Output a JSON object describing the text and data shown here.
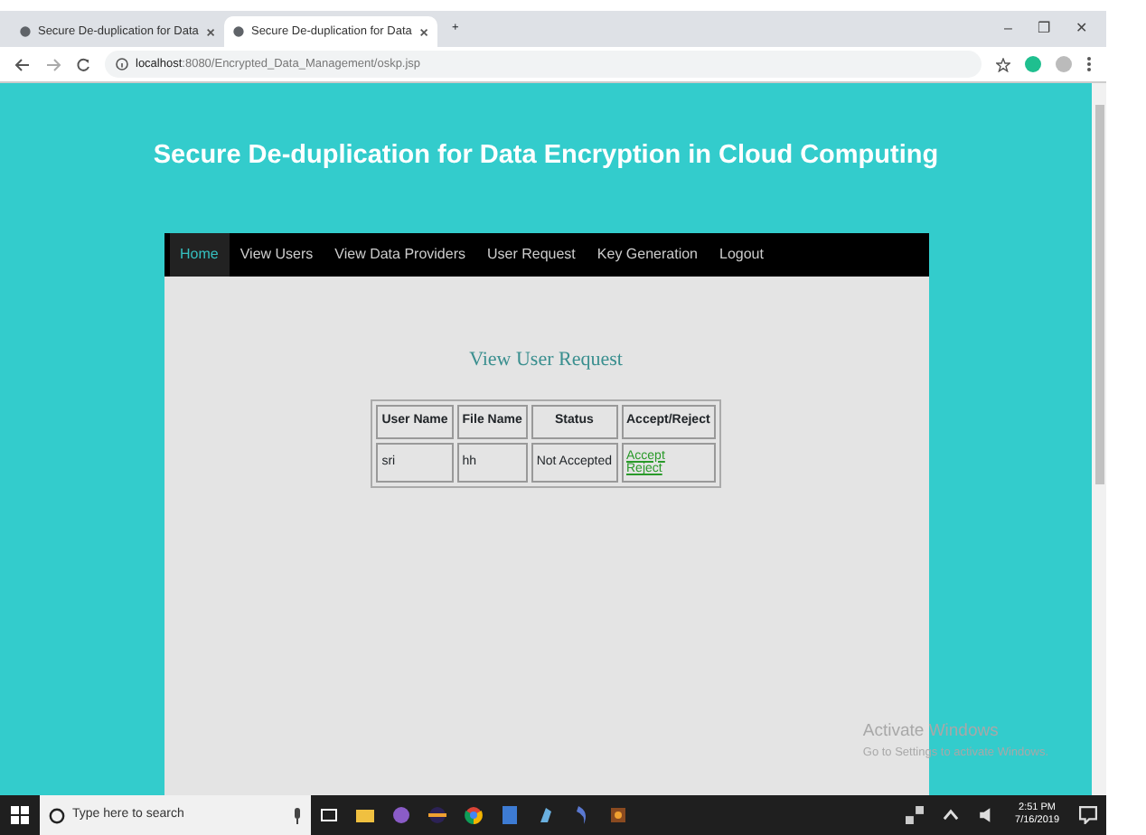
{
  "browser": {
    "tabs": [
      {
        "title": "Secure De-duplication for Data",
        "selected": false
      },
      {
        "title": "Secure De-duplication for Data",
        "selected": true
      }
    ],
    "new_tab": "+",
    "window_controls": [
      "–",
      "❐",
      "✕"
    ],
    "url_host": "localhost",
    "url_path": ":8080/Encrypted_Data_Management/oskp.jsp"
  },
  "page": {
    "title": "Secure De-duplication for Data Encryption in Cloud Computing",
    "nav": [
      {
        "label": "Home",
        "selected": true
      },
      {
        "label": "View Users",
        "selected": false
      },
      {
        "label": "View Data Providers",
        "selected": false
      },
      {
        "label": "User Request",
        "selected": false
      },
      {
        "label": "Key Generation",
        "selected": false
      },
      {
        "label": "Logout",
        "selected": false
      }
    ],
    "heading": "View User Request",
    "table": {
      "columns": [
        "User Name",
        "File Name",
        "Status",
        "Accept/Reject"
      ],
      "rows": [
        {
          "user": "sri",
          "file": "hh",
          "status": "Not Accepted",
          "actions": [
            "Accept",
            "Reject"
          ]
        }
      ]
    }
  },
  "activation": {
    "title": "Activate Windows",
    "text": "Go to Settings to activate Windows."
  },
  "taskbar": {
    "search_placeholder": "Type here to search",
    "time": "2:51 PM",
    "date": "7/16/2019"
  }
}
